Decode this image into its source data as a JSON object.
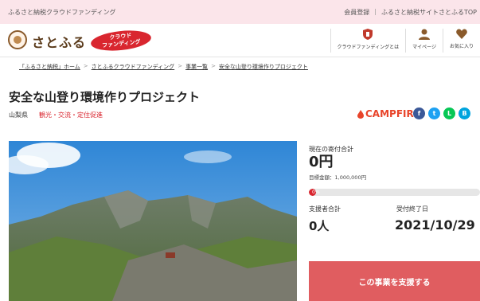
{
  "topbar": {
    "site_desc": "ふるさと納税クラウドファンディング",
    "links": [
      "会員登録",
      "ふるさと納税サイトさとふるTOP"
    ]
  },
  "header": {
    "logo_text": "さとふる",
    "badge_line1": "クラウド",
    "badge_line2": "ファンディング",
    "nav": [
      {
        "label": "クラウドファンディングとは",
        "icon": "shield-icon"
      },
      {
        "label": "マイページ",
        "icon": "user-icon"
      },
      {
        "label": "お気に入り",
        "icon": "heart-icon"
      }
    ]
  },
  "breadcrumb": [
    "「ふるさと納税」ホーム",
    "さとふるクラウドファンディング",
    "事業一覧",
    "安全な山登り環境作りプロジェクト"
  ],
  "project": {
    "title": "安全な山登り環境作りプロジェクト",
    "region": "山梨県",
    "category": "観光・交流・定住促進"
  },
  "share": {
    "campfire": "CAMPFIRE",
    "icons": [
      {
        "name": "facebook-icon",
        "glyph": "f",
        "color": "#3b5998"
      },
      {
        "name": "twitter-icon",
        "glyph": "t",
        "color": "#1da1f2"
      },
      {
        "name": "line-icon",
        "glyph": "L",
        "color": "#06c755"
      },
      {
        "name": "other-share-icon",
        "glyph": "B",
        "color": "#00a4de"
      }
    ]
  },
  "stats": {
    "total_label": "現在の寄付合計",
    "total_value": "0円",
    "goal": "目標金額：1,000,000円",
    "progress_text": "0%",
    "progress_fraction": 0.0,
    "supporters_label": "支援者合計",
    "supporters_value": "0人",
    "end_label": "受付終了日",
    "end_value": "2021/10/29"
  },
  "cta": {
    "label": "この事業を支援する"
  },
  "colors": {
    "accent": "#d9262f",
    "button": "#e05d60",
    "topbar": "#fbe5ea"
  }
}
